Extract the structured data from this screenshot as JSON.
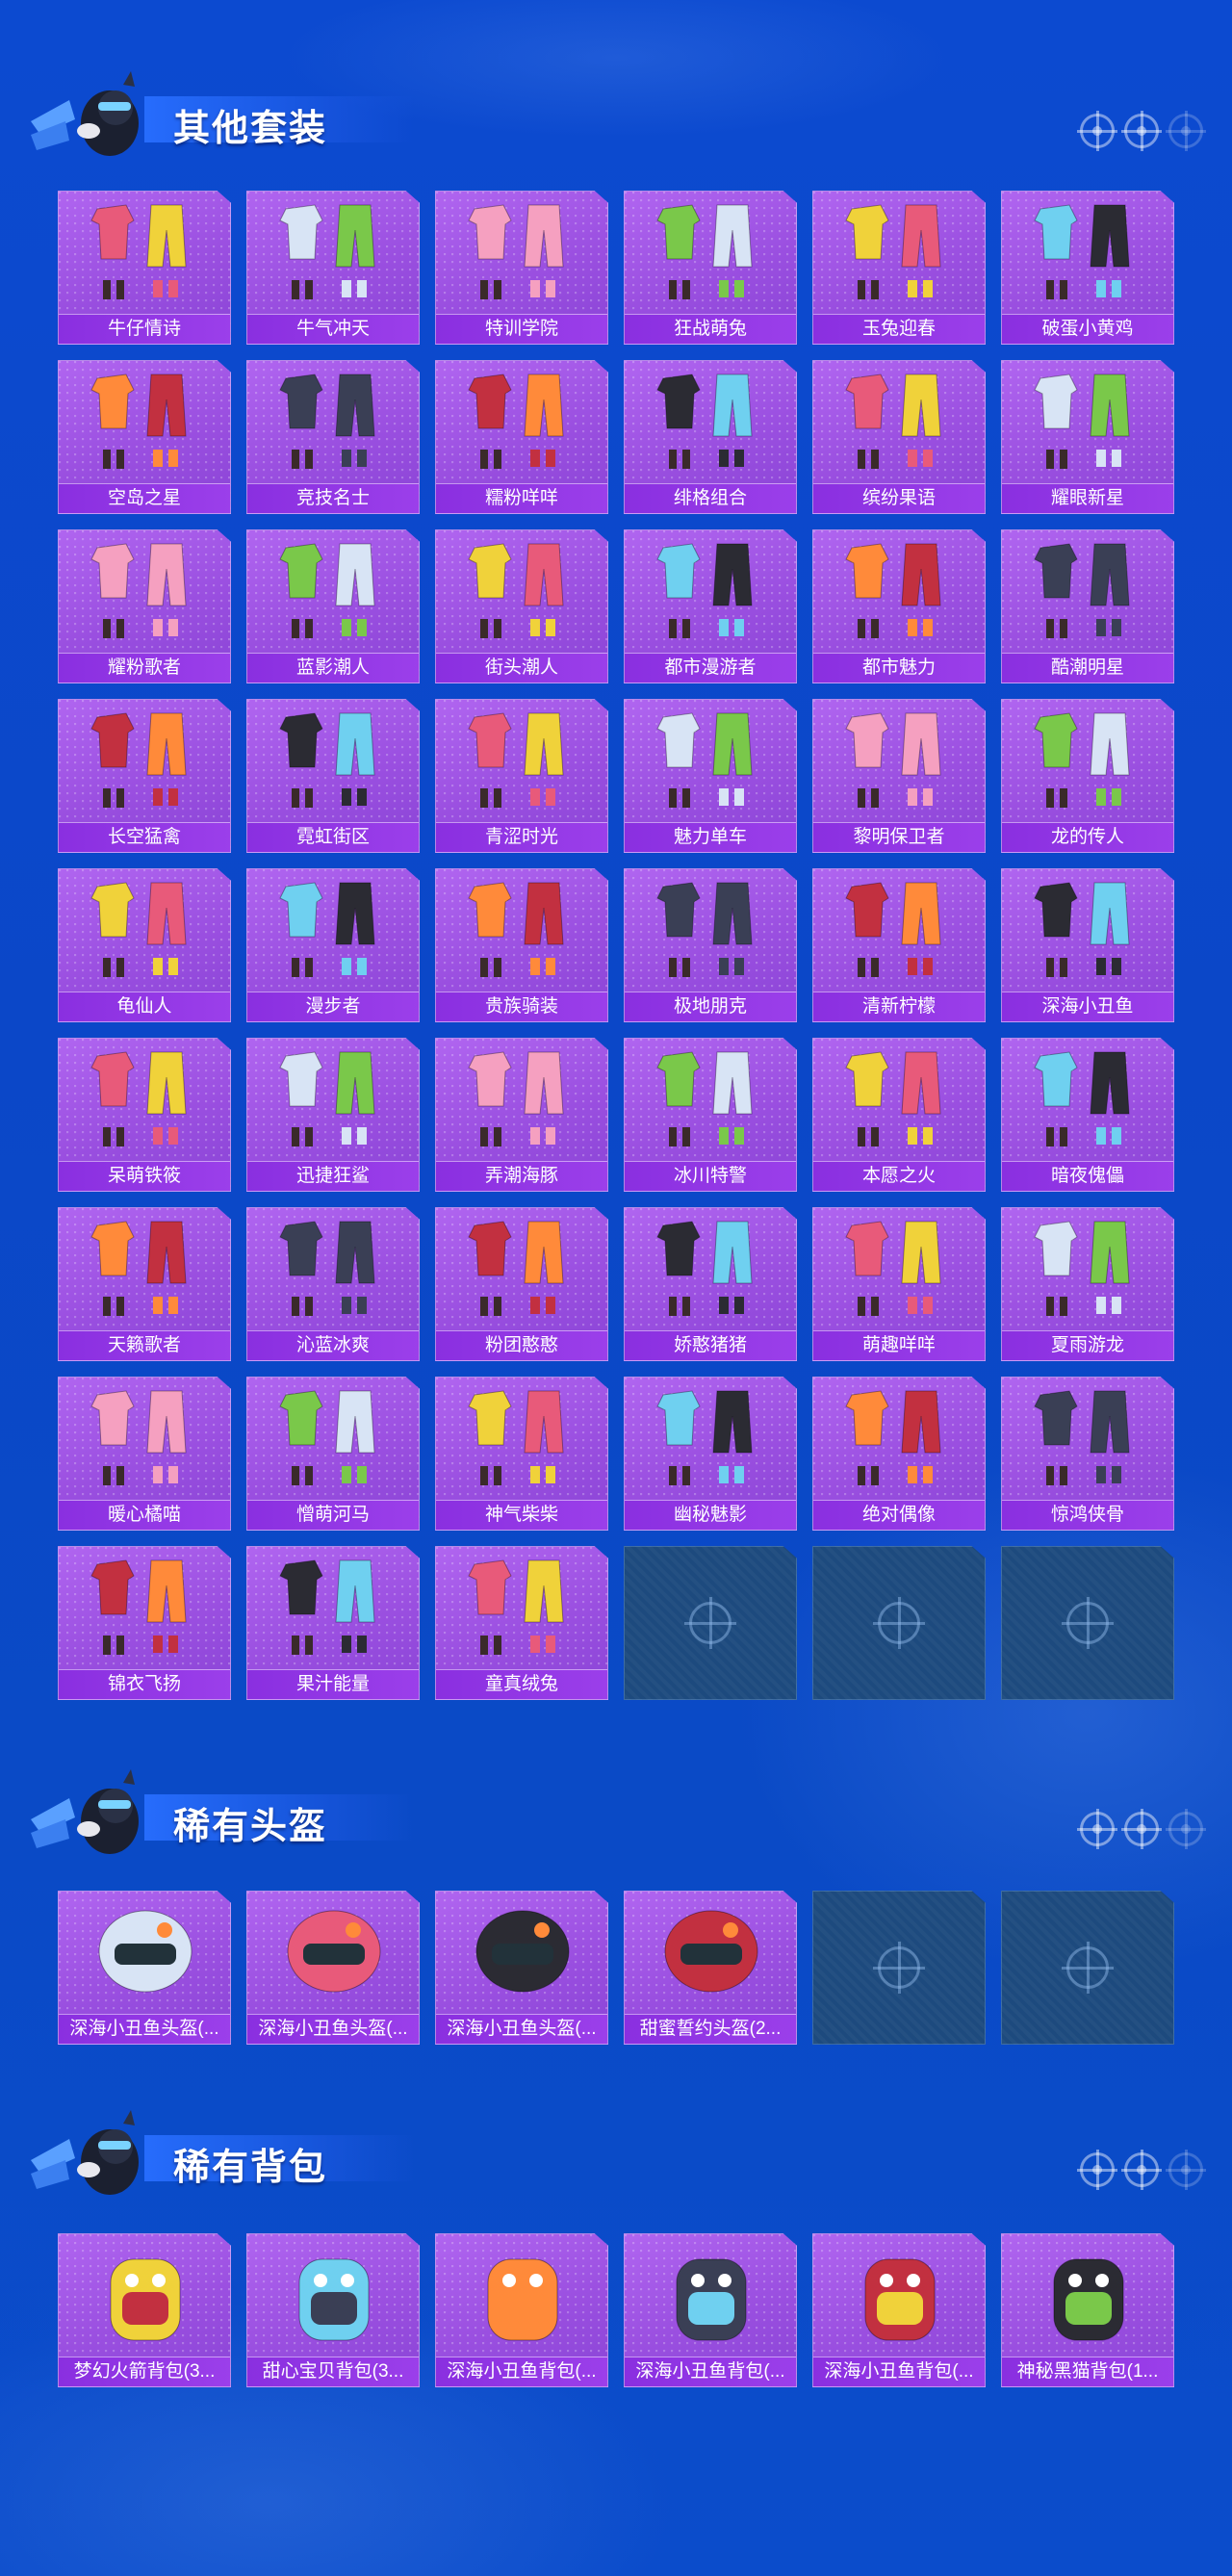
{
  "sections": [
    {
      "title": "其他套装",
      "items": [
        "牛仔情诗",
        "牛气冲天",
        "特训学院",
        "狂战萌兔",
        "玉兔迎春",
        "破蛋小黄鸡",
        "空岛之星",
        "竞技名士",
        "糯粉咩咩",
        "绯格组合",
        "缤纷果语",
        "耀眼新星",
        "耀粉歌者",
        "蓝影潮人",
        "街头潮人",
        "都市漫游者",
        "都市魅力",
        "酷潮明星",
        "长空猛禽",
        "霓虹街区",
        "青涩时光",
        "魅力单车",
        "黎明保卫者",
        "龙的传人",
        "龟仙人",
        "漫步者",
        "贵族骑装",
        "极地朋克",
        "清新柠檬",
        "深海小丑鱼",
        "呆萌铁筱",
        "迅捷狂鲨",
        "弄潮海豚",
        "冰川特警",
        "本愿之火",
        "暗夜傀儡",
        "天籁歌者",
        "沁蓝冰爽",
        "粉团憨憨",
        "娇憨猪猪",
        "萌趣咩咩",
        "夏雨游龙",
        "暖心橘喵",
        "憎萌河马",
        "神气柴柴",
        "幽秘魅影",
        "绝对偶像",
        "惊鸿侠骨",
        "锦衣飞扬",
        "果汁能量",
        "童真绒兔"
      ],
      "empty_slots": 3
    },
    {
      "title": "稀有头盔",
      "items": [
        "深海小丑鱼头盔(...",
        "深海小丑鱼头盔(...",
        "深海小丑鱼头盔(...",
        "甜蜜誓约头盔(2..."
      ],
      "empty_slots": 2
    },
    {
      "title": "稀有背包",
      "items": [
        "梦幻火箭背包(3...",
        "甜心宝贝背包(3...",
        "深海小丑鱼背包(...",
        "深海小丑鱼背包(...",
        "深海小丑鱼背包(...",
        "神秘黑猫背包(1..."
      ],
      "empty_slots": 0
    }
  ],
  "icons": {
    "mascot": "mascot-chicken-icon",
    "target": "crosshair-icon",
    "placeholder": "crosshair-icon"
  },
  "colors": {
    "background": "#0b47c8",
    "card_purple": "#9a4fe0",
    "label_purple": "#8a2fe0",
    "empty_slot": "#1d4a7e"
  }
}
